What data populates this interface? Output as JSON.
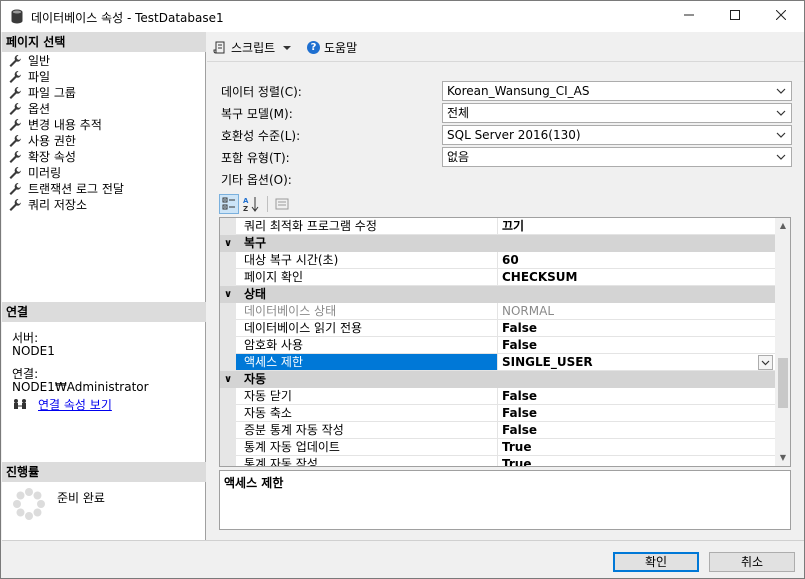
{
  "window": {
    "title": "데이터베이스 속성 - TestDatabase1",
    "icons": {
      "app": "database-icon",
      "minimize": "minimize-icon",
      "maximize": "maximize-icon",
      "close": "close-icon"
    }
  },
  "left_pane": {
    "page_select_header": "페이지 선택",
    "pages": [
      {
        "label": "일반",
        "icon": "wrench-icon"
      },
      {
        "label": "파일",
        "icon": "wrench-icon"
      },
      {
        "label": "파일 그룹",
        "icon": "wrench-icon"
      },
      {
        "label": "옵션",
        "icon": "wrench-icon"
      },
      {
        "label": "변경 내용 추적",
        "icon": "wrench-icon"
      },
      {
        "label": "사용 권한",
        "icon": "wrench-icon"
      },
      {
        "label": "확장 속성",
        "icon": "wrench-icon"
      },
      {
        "label": "미러링",
        "icon": "wrench-icon"
      },
      {
        "label": "트랜잭션 로그 전달",
        "icon": "wrench-icon"
      },
      {
        "label": "쿼리 저장소",
        "icon": "wrench-icon"
      }
    ],
    "connection_header": "연결",
    "server_label": "서버:",
    "server_value": "NODE1",
    "connection_label": "연결:",
    "connection_value": "NODE1₩Administrator",
    "view_connection_link": "연결 속성 보기",
    "progress_header": "진행률",
    "progress_status": "준비 완료"
  },
  "toolbar": {
    "script_label": "스크립트",
    "help_label": "도움말"
  },
  "fields": {
    "collation_label": "데이터 정렬(C):",
    "collation_value": "Korean_Wansung_CI_AS",
    "recovery_label": "복구 모델(M):",
    "recovery_value": "전체",
    "compat_label": "호환성 수준(L):",
    "compat_value": "SQL Server 2016(130)",
    "containment_label": "포함 유형(T):",
    "containment_value": "없음",
    "other_options_label": "기타 옵션(O):"
  },
  "property_grid": {
    "rows": [
      {
        "kind": "prop",
        "name": "쿼리 최적화 프로그램 수정",
        "value": "끄기"
      },
      {
        "kind": "cat",
        "name": "복구"
      },
      {
        "kind": "prop",
        "name": "대상 복구 시간(초)",
        "value": "60"
      },
      {
        "kind": "prop",
        "name": "페이지 확인",
        "value": "CHECKSUM"
      },
      {
        "kind": "cat",
        "name": "상태"
      },
      {
        "kind": "prop",
        "name": "데이터베이스 상태",
        "value": "NORMAL",
        "disabled": true
      },
      {
        "kind": "prop",
        "name": "데이터베이스 읽기 전용",
        "value": "False"
      },
      {
        "kind": "prop",
        "name": "암호화 사용",
        "value": "False"
      },
      {
        "kind": "prop",
        "name": "액세스 제한",
        "value": "SINGLE_USER",
        "selected": true
      },
      {
        "kind": "cat",
        "name": "자동"
      },
      {
        "kind": "prop",
        "name": "자동 닫기",
        "value": "False"
      },
      {
        "kind": "prop",
        "name": "자동 축소",
        "value": "False"
      },
      {
        "kind": "prop",
        "name": "증분 통계 자동 작성",
        "value": "False"
      },
      {
        "kind": "prop",
        "name": "통계 자동 업데이트",
        "value": "True"
      },
      {
        "kind": "prop",
        "name": "통계 자동 작성",
        "value": "True"
      }
    ],
    "description": "액세스 제한"
  },
  "buttons": {
    "ok": "확인",
    "cancel": "취소"
  }
}
